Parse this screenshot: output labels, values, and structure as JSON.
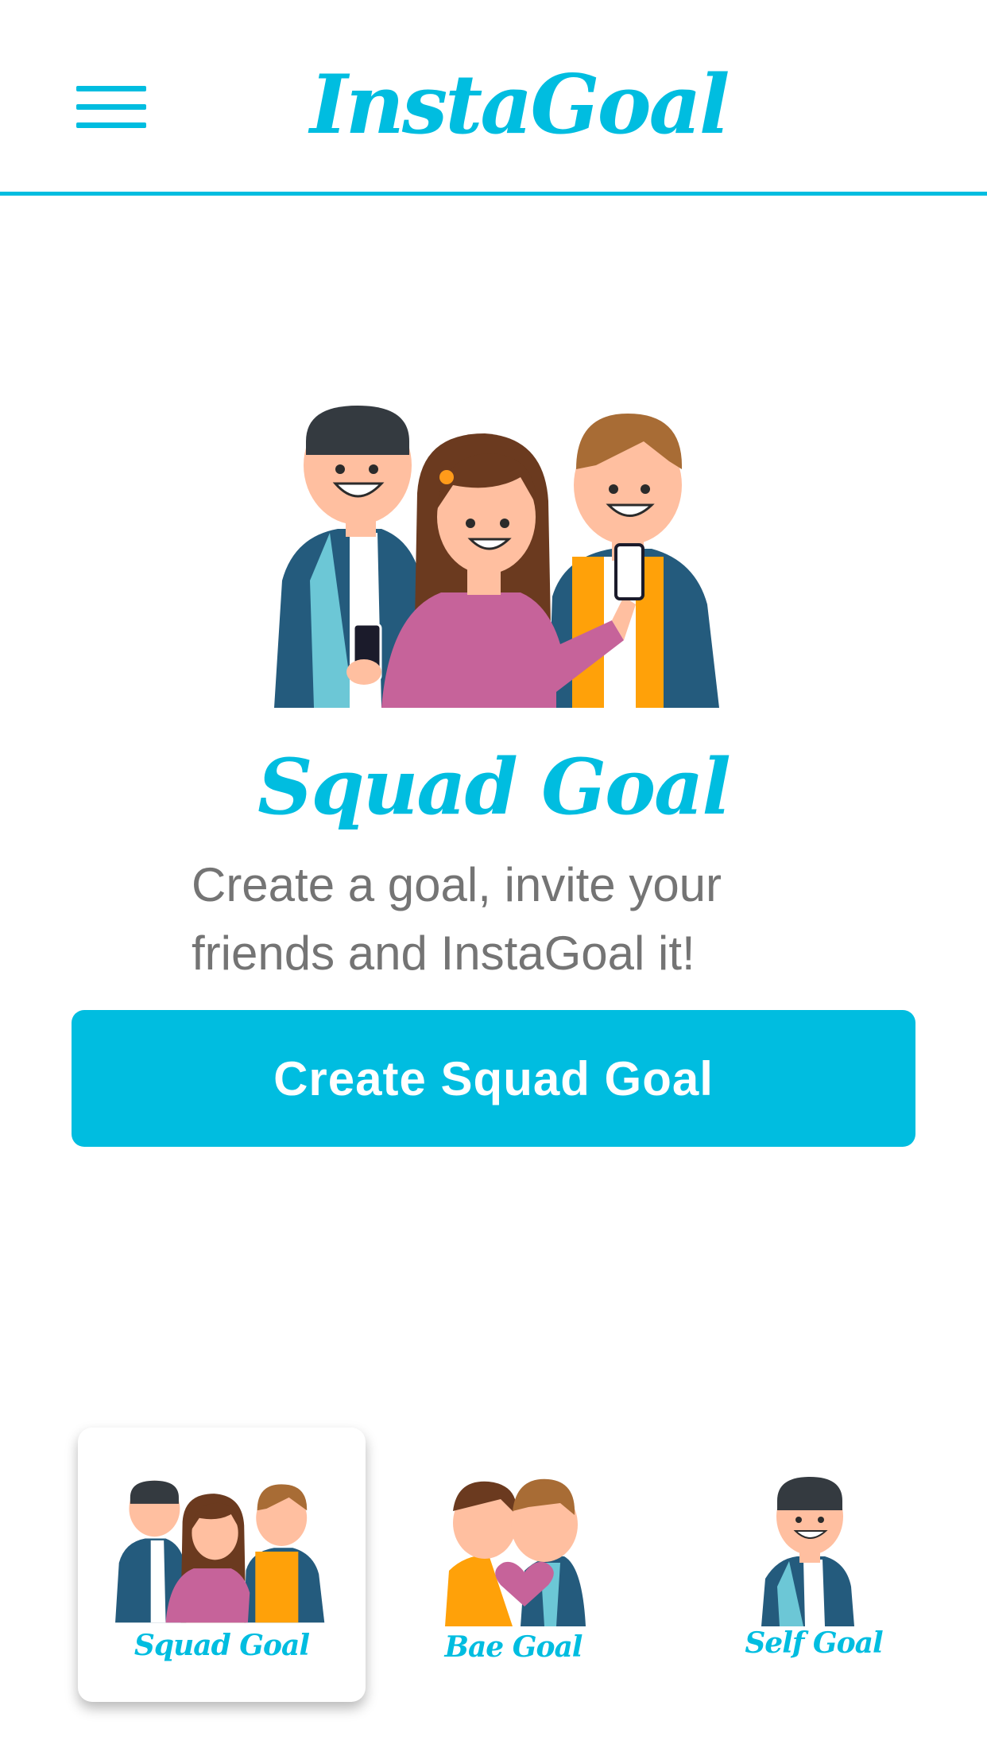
{
  "app": {
    "title": "InstaGoal"
  },
  "header": {
    "menu_icon": "hamburger-icon"
  },
  "hero": {
    "title": "Squad Goal",
    "description_line1": "Create a goal, invite your",
    "description_line2": "friends and InstaGoal it!",
    "cta_label": "Create Squad Goal"
  },
  "goal_types": [
    {
      "label": "Squad Goal",
      "active": true
    },
    {
      "label": "Bae Goal",
      "active": false
    },
    {
      "label": "Self Goal",
      "active": false
    }
  ],
  "colors": {
    "accent": "#00bde0",
    "text_gray": "#747474",
    "background": "#ffffff"
  }
}
